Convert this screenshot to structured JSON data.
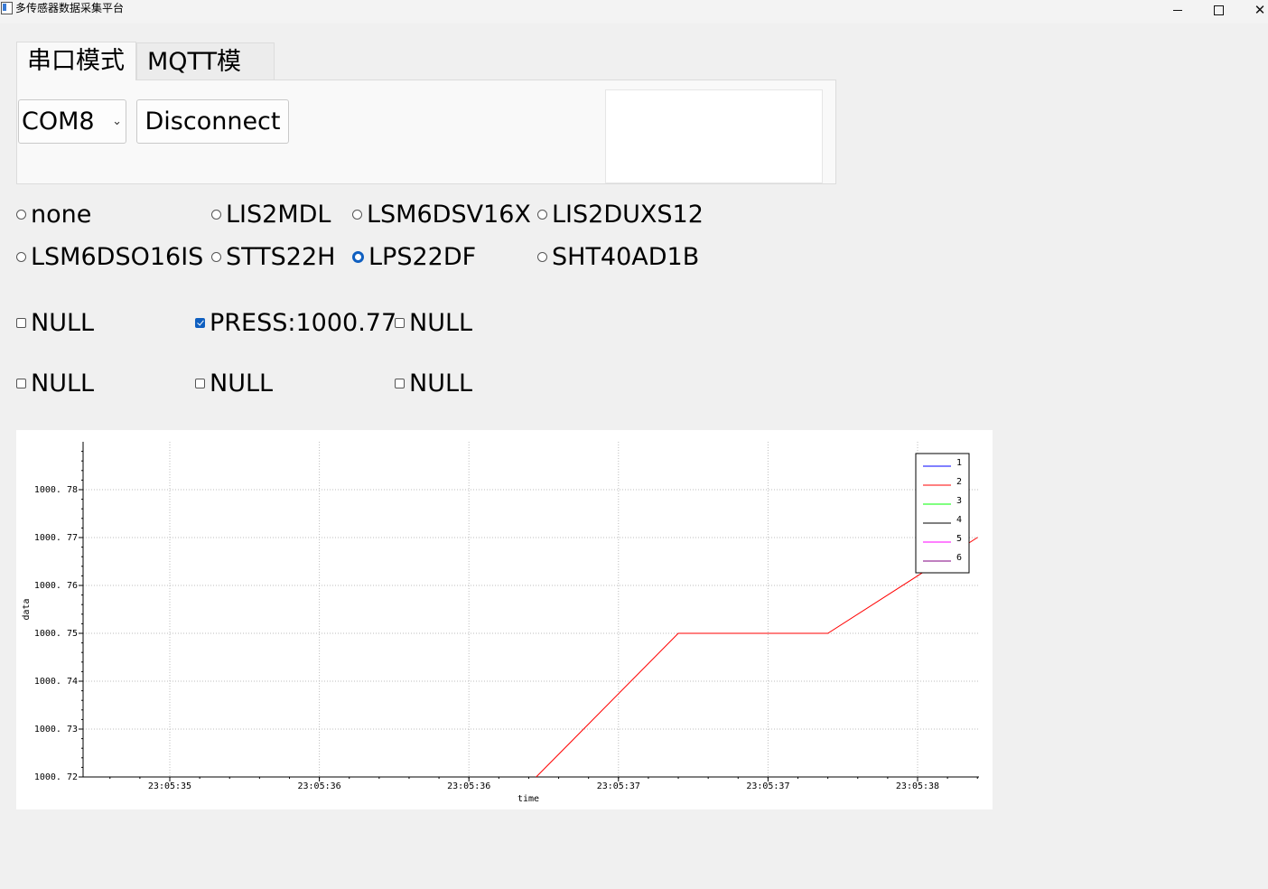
{
  "window": {
    "title": "多传感器数据采集平台",
    "minimize": "",
    "maximize": "",
    "close": "✕"
  },
  "tabs": [
    {
      "label": "串口模式",
      "active": true
    },
    {
      "label": "MQTT模式",
      "active": false
    }
  ],
  "serial": {
    "port_value": "COM8",
    "chevron": "⌄",
    "connect_button": "Disconnect"
  },
  "sensors": [
    {
      "label": "none",
      "checked": false
    },
    {
      "label": "LIS2MDL",
      "checked": false
    },
    {
      "label": "LSM6DSV16X",
      "checked": false
    },
    {
      "label": "LIS2DUXS12",
      "checked": false
    },
    {
      "label": "LSM6DSO16IS",
      "checked": false
    },
    {
      "label": "STTS22H",
      "checked": false
    },
    {
      "label": "LPS22DF",
      "checked": true
    },
    {
      "label": "SHT40AD1B",
      "checked": false
    }
  ],
  "channels": [
    {
      "label": "NULL",
      "checked": false
    },
    {
      "label": "PRESS:1000.77",
      "checked": true
    },
    {
      "label": "NULL",
      "checked": false
    },
    {
      "label": "NULL",
      "checked": false
    },
    {
      "label": "NULL",
      "checked": false
    },
    {
      "label": "NULL",
      "checked": false
    }
  ],
  "colors": {
    "accent": "#0f5fc0",
    "series": [
      "#0000ff",
      "#ff0000",
      "#00ff00",
      "#000000",
      "#ff00ff",
      "#800080"
    ]
  },
  "chart_data": {
    "type": "line",
    "xlabel": "time",
    "ylabel": "data",
    "ylim": [
      1000.72,
      1000.79
    ],
    "y_ticks": [
      "1000. 72",
      "1000. 73",
      "1000. 74",
      "1000. 75",
      "1000. 76",
      "1000. 77",
      "1000. 78"
    ],
    "x_ticks": [
      "23:05:35",
      "23:05:36",
      "23:05:36",
      "23:05:37",
      "23:05:37",
      "23:05:38"
    ],
    "grid": true,
    "legend_position": "top-right",
    "legend": [
      "1",
      "2",
      "3",
      "4",
      "5",
      "6"
    ],
    "series": [
      {
        "name": "2",
        "color": "#ff0000",
        "points": [
          {
            "x_tick": 2.45,
            "y": 1000.72
          },
          {
            "x_tick": 3.4,
            "y": 1000.75
          },
          {
            "x_tick": 4.4,
            "y": 1000.75
          },
          {
            "x_tick": 5.4,
            "y": 1000.77
          }
        ]
      }
    ]
  }
}
